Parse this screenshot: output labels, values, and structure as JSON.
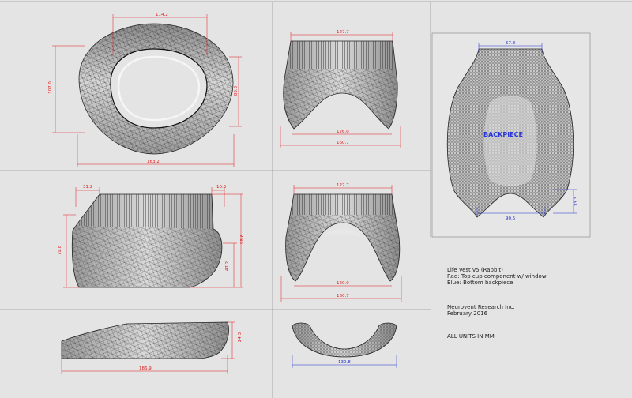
{
  "dims": {
    "top_width": "114.2",
    "top_height_left": "107.0",
    "top_height_right": "88.0",
    "top_bottom_width": "163.2",
    "front_top": "127.7",
    "front_inner": "126.0",
    "front_outer": "160.7",
    "back_top": "57.8",
    "back_right": "33.3",
    "back_bottom": "90.5",
    "side_top_left": "31.2",
    "side_top_right": "10.5",
    "side_left": "79.8",
    "side_right_outer": "98.6",
    "side_right_inner": "47.2",
    "rear_top": "127.7",
    "rear_inner": "120.0",
    "rear_outer": "160.7",
    "flat_height": "24.3",
    "flat_width": "186.9",
    "arch_width": "130.8"
  },
  "backpiece_label": "BACKPIECE",
  "notes": {
    "line1": "Life Vest v5 (Rabbit)",
    "line2": "Red: Top cup component w/ window",
    "line3": "Blue: Bottom backpiece",
    "company": "Neurovent Research Inc.",
    "date": "February 2016",
    "units": "ALL UNITS IN MM"
  },
  "colors": {
    "red_dim": "#e01818",
    "blue_dim": "#2030d0",
    "mesh": "#303030",
    "surface": "#b8b8b8"
  }
}
